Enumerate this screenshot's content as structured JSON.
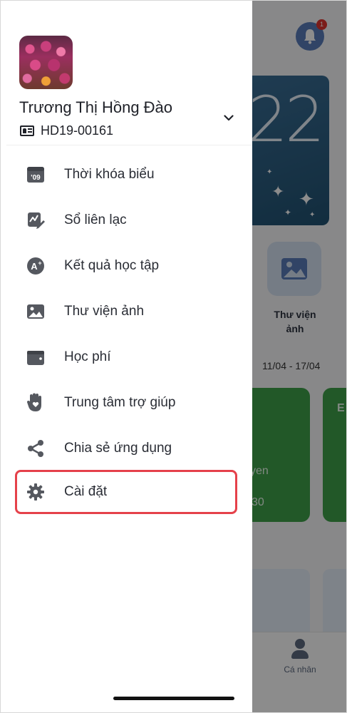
{
  "background": {
    "notification_badge": "1",
    "banner_number": "22",
    "tile_label": "Thư viện ảnh",
    "date_range": "11/04 - 17/04",
    "card_text_1": "yen",
    "card_text_2": "30",
    "card_text_3": "E",
    "profile_tab_label": "Cá nhân"
  },
  "drawer": {
    "user": {
      "name": "Trương Thị Hồng Đào",
      "student_id": "HD19-00161"
    },
    "menu": [
      {
        "label": "Thời khóa biểu",
        "icon": "calendar-09-icon"
      },
      {
        "label": "Sổ liên lạc",
        "icon": "chart-pen-icon"
      },
      {
        "label": "Kết quả học tập",
        "icon": "grade-a-plus-icon"
      },
      {
        "label": "Thư viện ảnh",
        "icon": "image-icon"
      },
      {
        "label": "Học phí",
        "icon": "wallet-icon"
      },
      {
        "label": "Trung tâm trợ giúp",
        "icon": "hand-heart-icon"
      },
      {
        "label": "Chia sẻ ứng dụng",
        "icon": "share-icon"
      },
      {
        "label": "Cài đặt",
        "icon": "gear-icon",
        "highlighted": true
      }
    ]
  },
  "colors": {
    "highlight_border": "#e5414a",
    "icon_gray": "#55585f",
    "text_dark": "#1f2128"
  }
}
